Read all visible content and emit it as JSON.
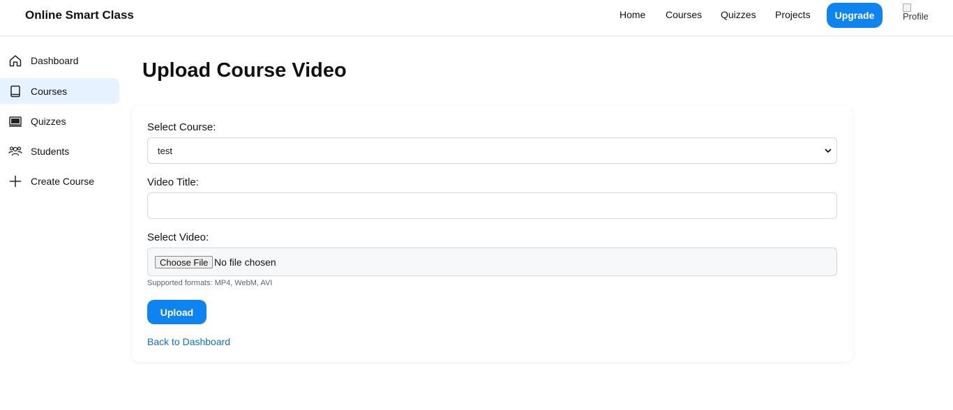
{
  "header": {
    "brand": "Online Smart Class",
    "nav": [
      "Home",
      "Courses",
      "Quizzes",
      "Projects"
    ],
    "upgrade_label": "Upgrade",
    "profile_alt": "Profile"
  },
  "sidebar": {
    "items": [
      {
        "label": "Dashboard",
        "icon": "home-icon"
      },
      {
        "label": "Courses",
        "icon": "book-icon",
        "active": true
      },
      {
        "label": "Quizzes",
        "icon": "quiz-board-icon"
      },
      {
        "label": "Students",
        "icon": "users-icon"
      },
      {
        "label": "Create Course",
        "icon": "plus-icon"
      }
    ]
  },
  "main": {
    "title": "Upload Course Video",
    "form": {
      "course_label": "Select Course:",
      "course_value": "test",
      "title_label": "Video Title:",
      "title_value": "",
      "video_label": "Select Video:",
      "choose_file_label": "Choose File",
      "no_file_text": "No file chosen",
      "formats_hint": "Supported formats: MP4, WebM, AVI",
      "upload_label": "Upload",
      "back_link": "Back to Dashboard"
    }
  },
  "colors": {
    "accent": "#0d84f0",
    "active_bg": "#e6f2ff",
    "link": "#0d6fd6"
  }
}
